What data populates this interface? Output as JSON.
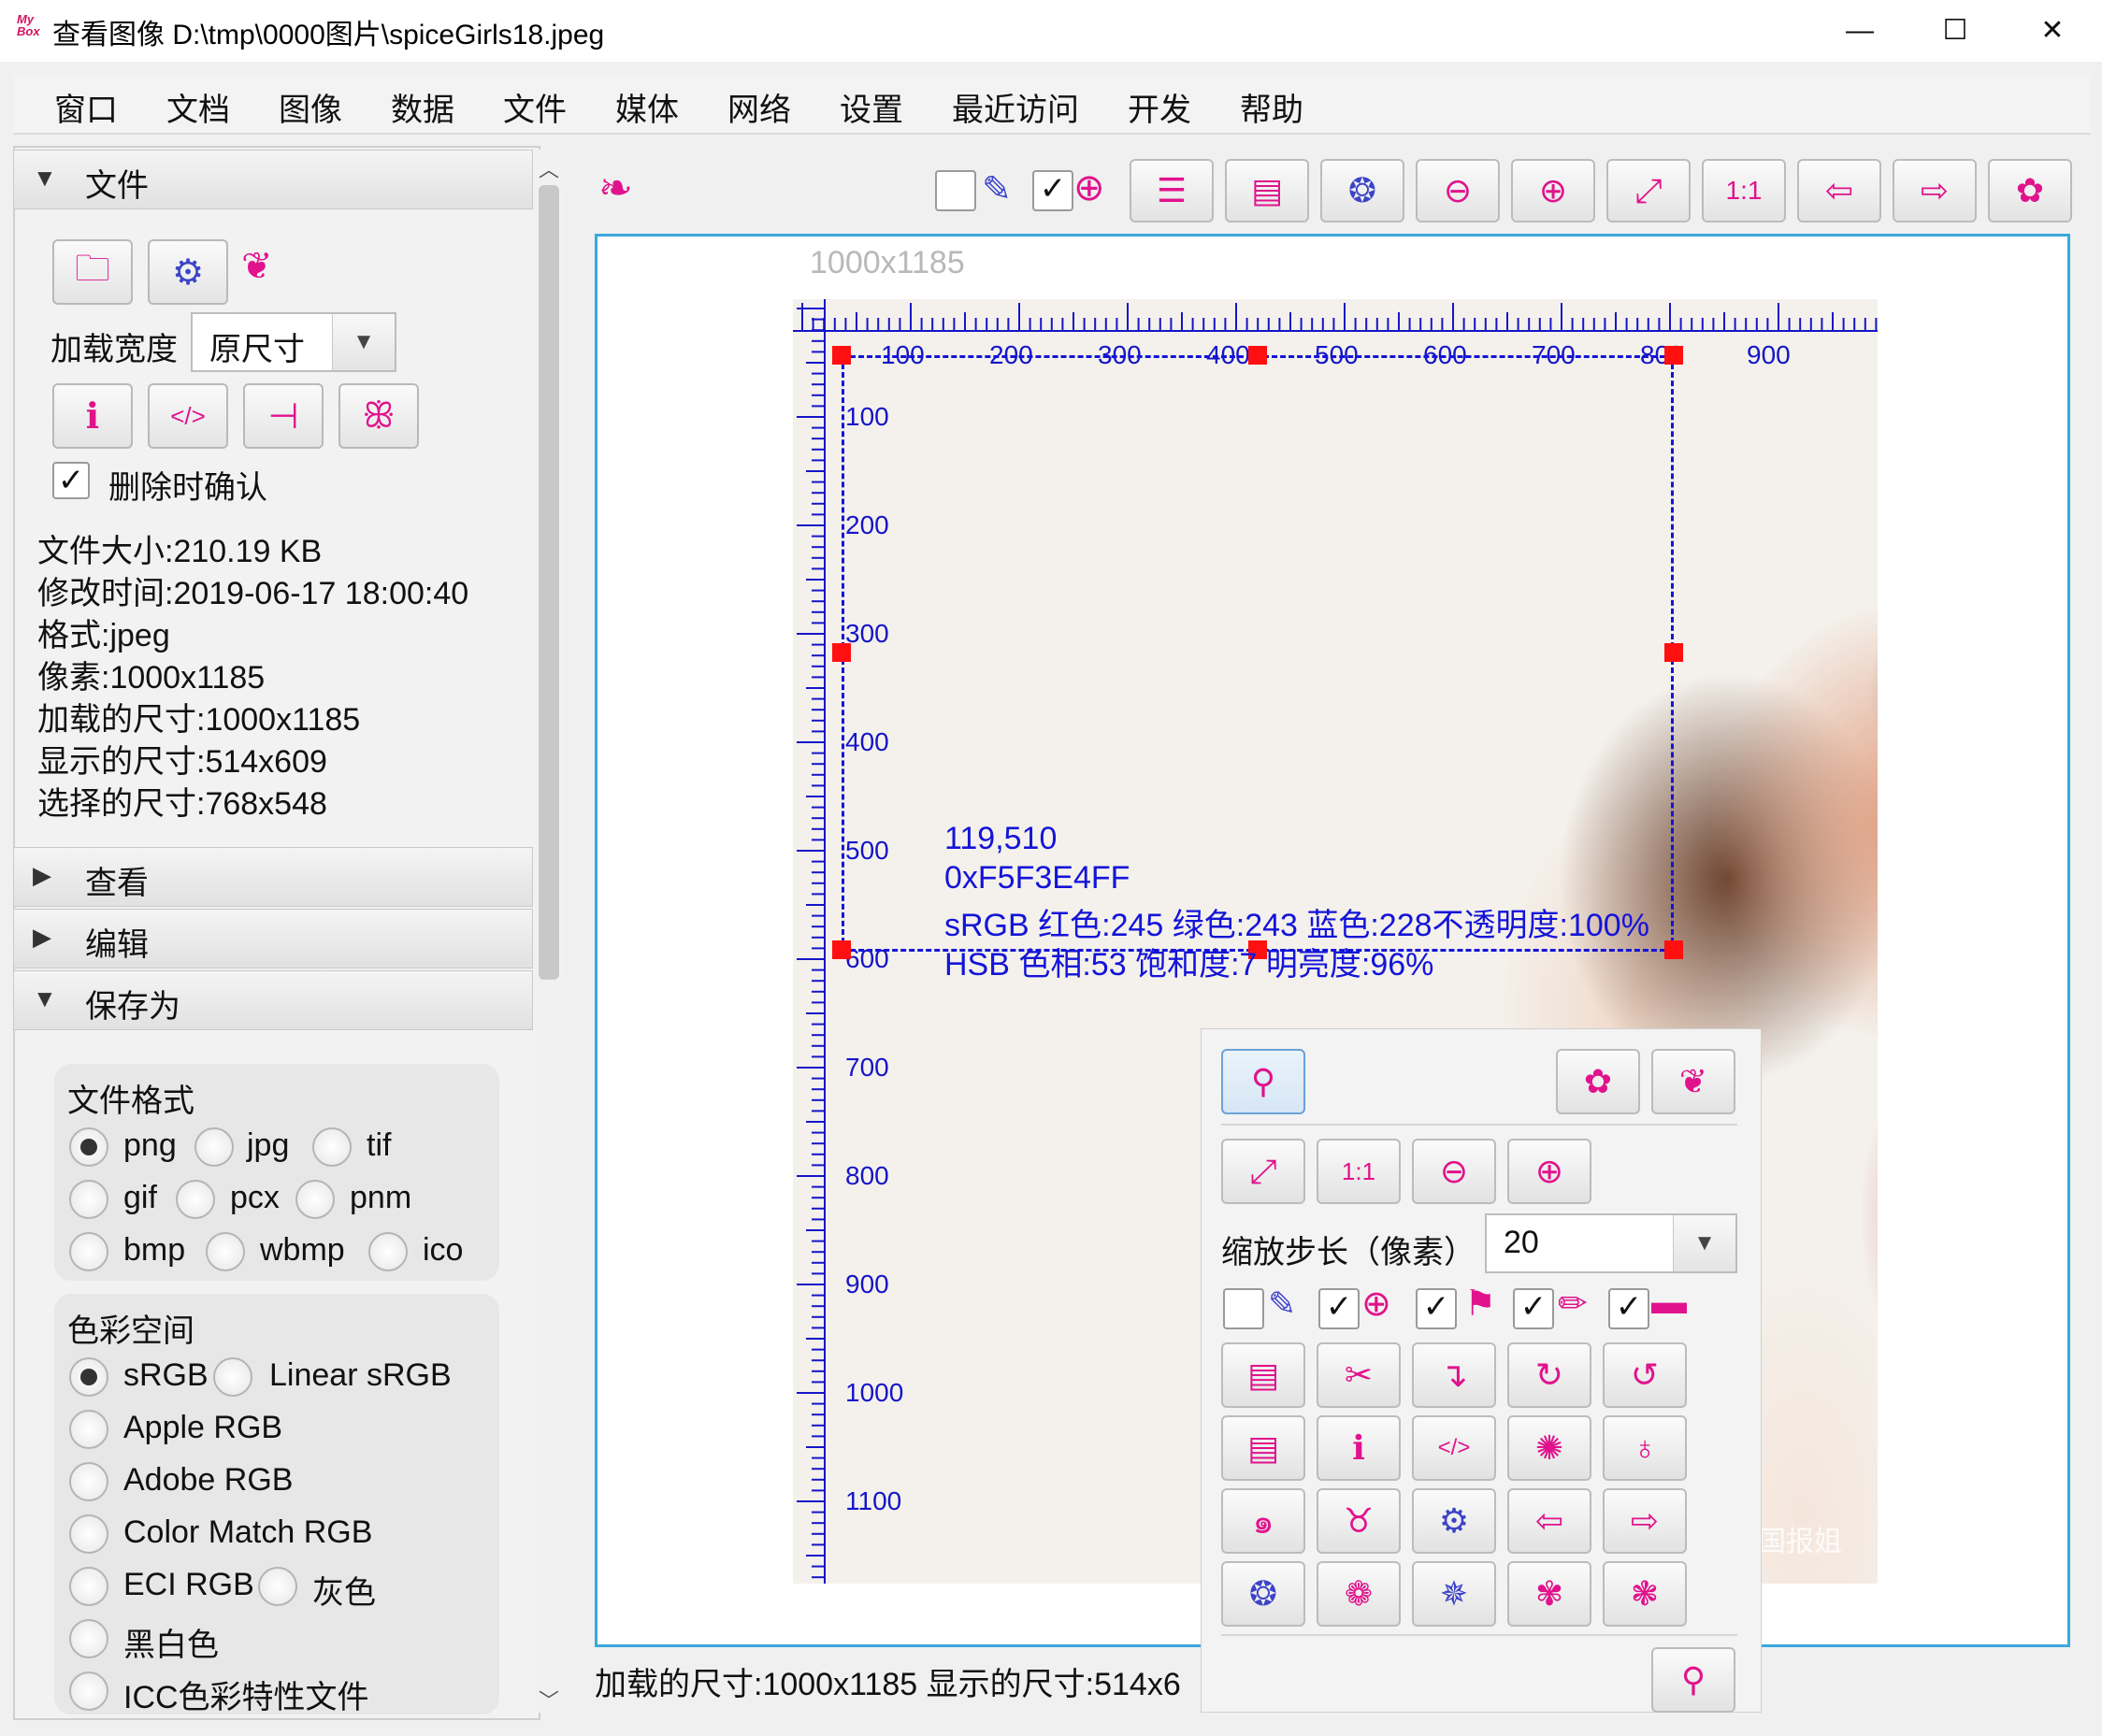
{
  "window": {
    "logo_text": "My Box",
    "title": "查看图像 D:\\tmp\\0000图片\\spiceGirls18.jpeg",
    "minimize": "—",
    "maximize": "☐",
    "close": "✕"
  },
  "menu": [
    "窗口",
    "文档",
    "图像",
    "数据",
    "文件",
    "媒体",
    "网络",
    "设置",
    "最近访问",
    "开发",
    "帮助"
  ],
  "file_section": {
    "title": "文件",
    "load_width_label": "加载宽度",
    "load_width_value": "原尺寸",
    "confirm_delete_label": "删除时确认",
    "confirm_delete_checked": true,
    "info": [
      "文件大小:210.19 KB",
      "修改时间:2019-06-17 18:00:40",
      "格式:jpeg",
      "像素:1000x1185",
      "加载的尺寸:1000x1185",
      "显示的尺寸:514x609",
      "选择的尺寸:768x548"
    ]
  },
  "sections": {
    "view": "查看",
    "edit": "编辑",
    "save_as": "保存为"
  },
  "save_as": {
    "format_label": "文件格式",
    "formats": [
      "png",
      "jpg",
      "tif",
      "gif",
      "pcx",
      "pnm",
      "bmp",
      "wbmp",
      "ico"
    ],
    "selected_format": "png",
    "colorspace_label": "色彩空间",
    "colorspaces": [
      "sRGB",
      "Linear sRGB",
      "Apple RGB",
      "Adobe RGB",
      "Color Match RGB",
      "ECI RGB",
      "灰色",
      "黑白色",
      "ICC色彩特性文件"
    ],
    "selected_colorspace": "sRGB"
  },
  "image": {
    "dimensions_label": "1000x1185",
    "ruler_top": [
      "100",
      "200",
      "300",
      "400",
      "500",
      "600",
      "700",
      "800",
      "900"
    ],
    "ruler_left": [
      "100",
      "200",
      "300",
      "400",
      "500",
      "600",
      "700",
      "800",
      "900",
      "1000",
      "1100"
    ],
    "pixel_info": [
      "119,510",
      "0xF5F3E4FF",
      "sRGB  红色:245  绿色:243  蓝色:228不透明度:100%",
      "HSB  色相:53  饱和度:7  明亮度:96%"
    ],
    "watermark": "国报姐"
  },
  "float_panel": {
    "zoom_step_label": "缩放步长（像素）",
    "zoom_step_value": "20"
  },
  "status_bar": "加载的尺寸:1000x1185  显示的尺寸:514x6",
  "colors": {
    "accent_pink": "#e0138c",
    "accent_blue": "#3c44c8",
    "ruler_blue": "#1515c8",
    "frame_blue": "#3ba9dd",
    "handle_red": "#ff1010"
  }
}
